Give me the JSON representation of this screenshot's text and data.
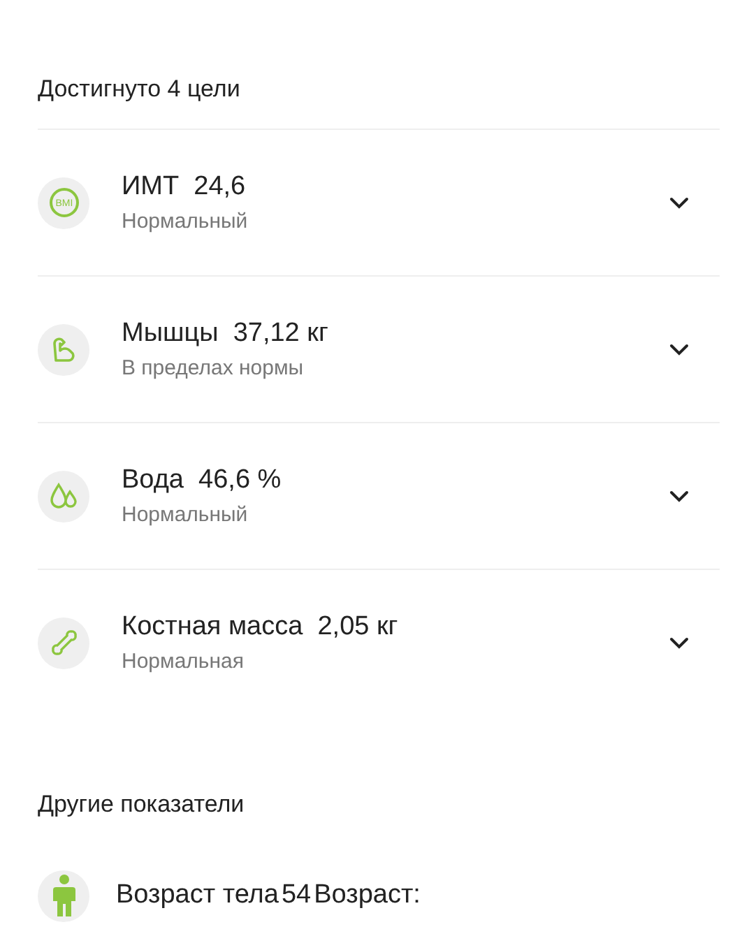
{
  "goals_header": "Достигнуто 4 цели",
  "metrics": [
    {
      "kind": "bmi",
      "icon_text": "BMI",
      "name": "ИМТ",
      "value": "24,6",
      "status": "Нормальный",
      "expanded": false
    },
    {
      "kind": "muscle",
      "name": "Мышцы",
      "value": "37,12 кг",
      "status": "В пределах нормы",
      "expanded": false
    },
    {
      "kind": "water",
      "name": "Вода",
      "value": "46,6 %",
      "status": "Нормальный",
      "expanded": false
    },
    {
      "kind": "bone",
      "name": "Костная масса",
      "value": "2,05 кг",
      "status": "Нормальная",
      "expanded": false
    }
  ],
  "other_header": "Другие показатели",
  "other": [
    {
      "kind": "body",
      "label": "Возраст тела",
      "value": "54",
      "suffix": "Возраст:"
    }
  ]
}
